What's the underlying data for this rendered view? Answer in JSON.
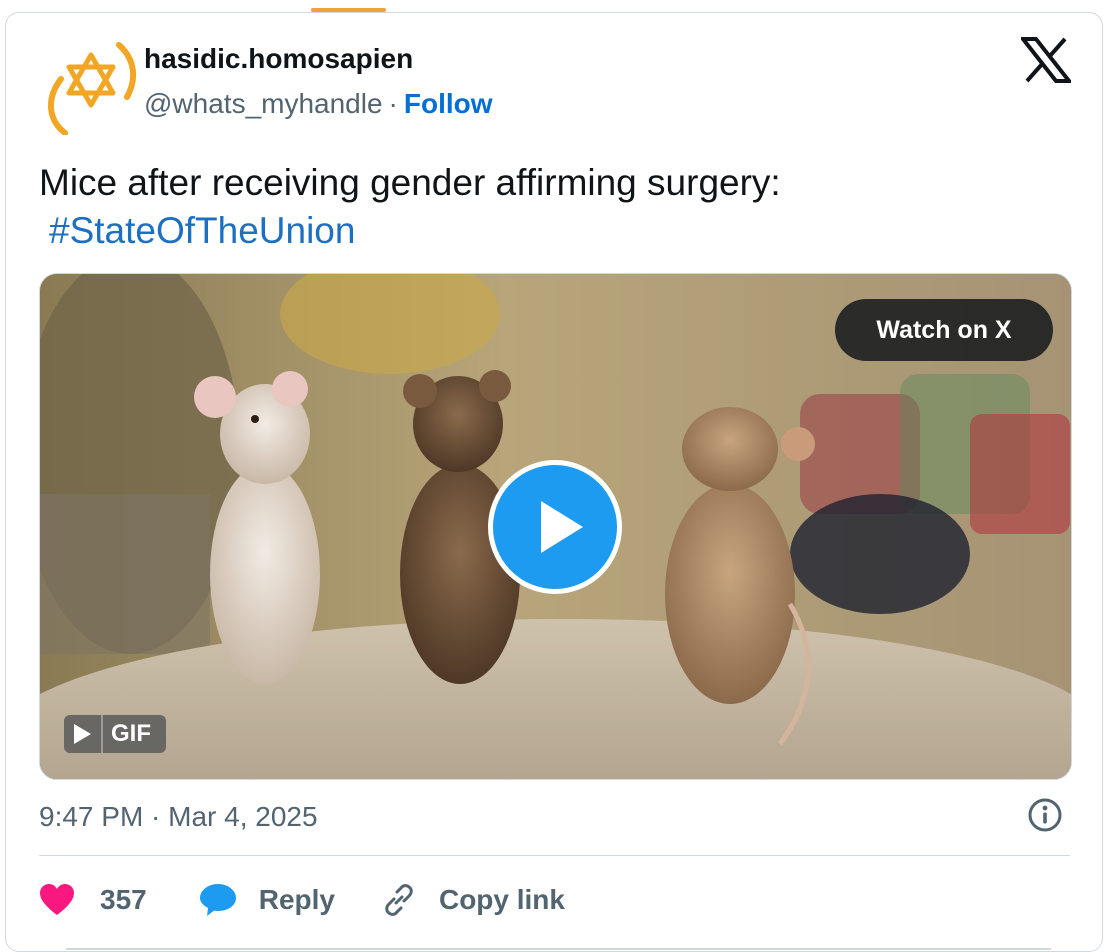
{
  "author": {
    "display_name": "hasidic.homosapien",
    "handle": "@whats_myhandle",
    "separator": "·",
    "follow_label": "Follow",
    "avatar_icon": "star-of-david-icon"
  },
  "brand": {
    "logo_icon": "x-logo-icon"
  },
  "tweet": {
    "text": "Mice after receiving gender affirming surgery:",
    "hashtag": "#StateOfTheUnion"
  },
  "media": {
    "watch_label": "Watch on X",
    "gif_label": "GIF",
    "play_icon": "play-icon"
  },
  "meta": {
    "timestamp": "9:47 PM · Mar 4, 2025",
    "info_icon": "info-icon"
  },
  "actions": {
    "like_count": "357",
    "reply_label": "Reply",
    "copy_link_label": "Copy link"
  },
  "colors": {
    "accent_link": "#006fd6",
    "hashtag": "#1d6fc1",
    "like_heart": "#f91880",
    "reply_bubble": "#1d9bf0",
    "play_button": "#1d9bf0",
    "avatar_gold": "#f2a623"
  }
}
